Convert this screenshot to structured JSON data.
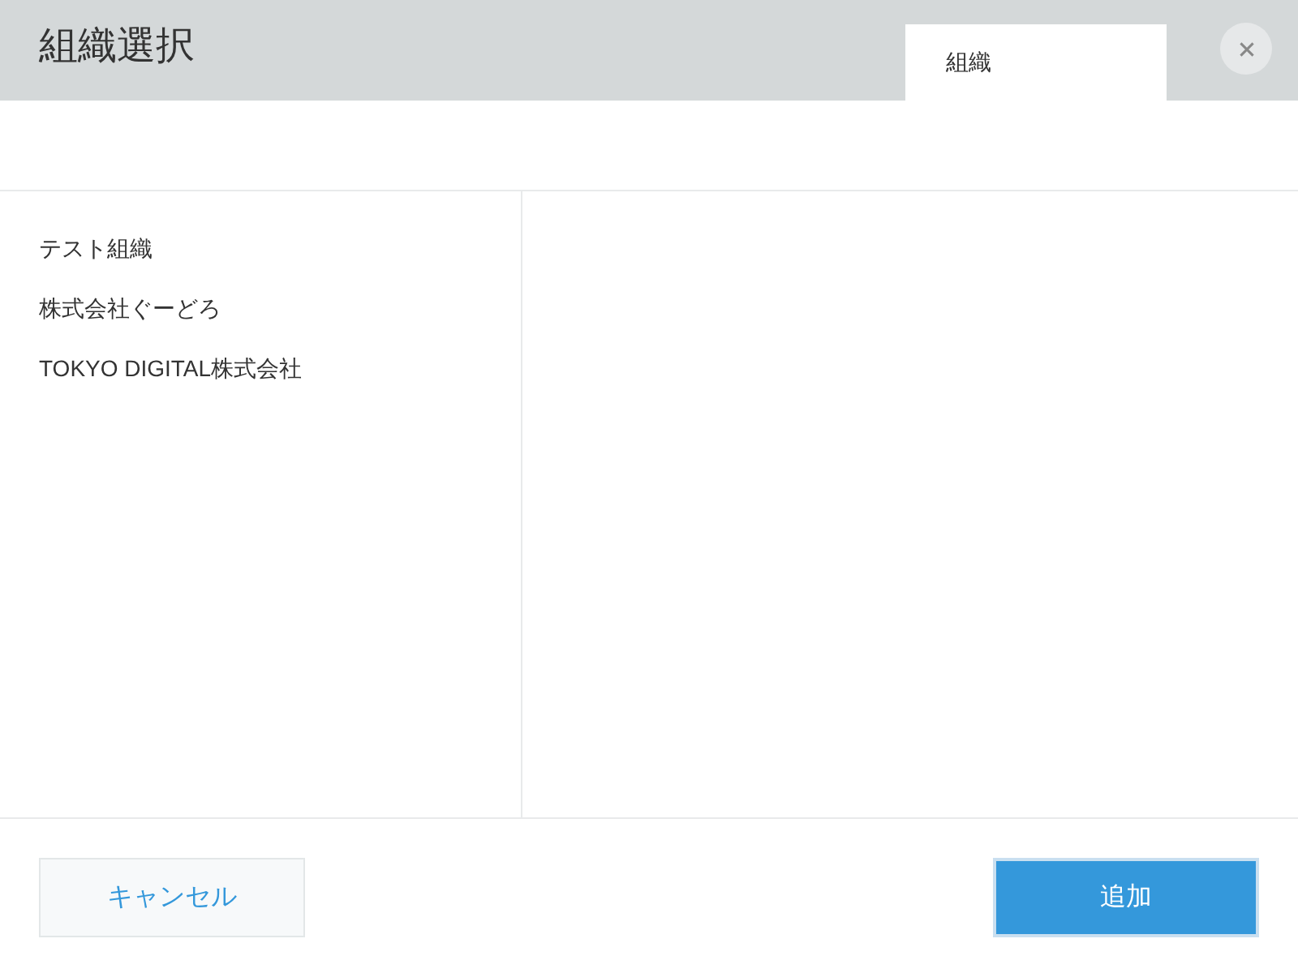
{
  "dialog": {
    "title": "組織選択"
  },
  "tabs": [
    {
      "label": "組織",
      "selected": true
    }
  ],
  "organizations": [
    {
      "name": "テスト組織",
      "selected": false
    },
    {
      "name": "株式会社ぐーどろ",
      "selected": false
    },
    {
      "name": "TOKYO DIGITAL株式会社",
      "selected": false
    }
  ],
  "buttons": [
    {
      "kind": "secondary",
      "label": "キャンセル"
    },
    {
      "kind": "primary",
      "label": "追加"
    }
  ]
}
